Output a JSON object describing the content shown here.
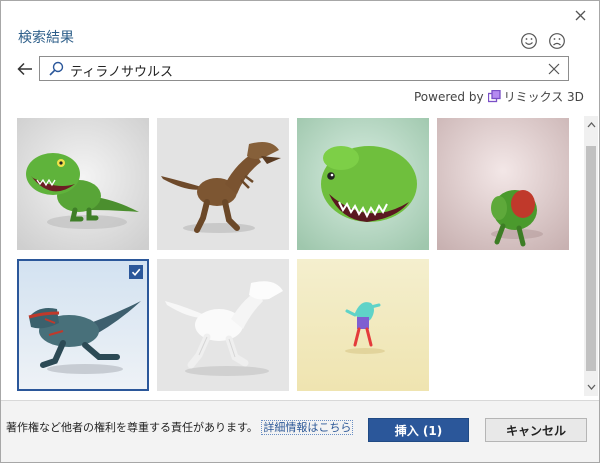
{
  "dialog": {
    "title": "検索結果",
    "close_icon": "close-icon",
    "feedback_positive_icon": "smiley-icon",
    "feedback_negative_icon": "frown-icon"
  },
  "search": {
    "back_icon": "back-arrow-icon",
    "search_icon": "search-icon",
    "query": "ティラノサウルス",
    "clear_icon": "clear-icon"
  },
  "attribution": {
    "prefix": "Powered by",
    "logo_icon": "remix3d-logo-icon",
    "provider": "リミックス 3D"
  },
  "results": [
    {
      "name": "result-1",
      "selected": false
    },
    {
      "name": "result-2",
      "selected": false
    },
    {
      "name": "result-3",
      "selected": false
    },
    {
      "name": "result-4",
      "selected": false
    },
    {
      "name": "result-5",
      "selected": true
    },
    {
      "name": "result-6",
      "selected": false
    },
    {
      "name": "result-7",
      "selected": false
    }
  ],
  "footer": {
    "notice": "著作権など他者の権利を尊重する責任があります。",
    "details_link": "詳細情報はこちら",
    "insert_button": "挿入 (1)",
    "cancel_button": "キャンセル"
  },
  "colors": {
    "accent": "#2b579a",
    "title": "#2e5f8a",
    "link": "#2b5797"
  }
}
